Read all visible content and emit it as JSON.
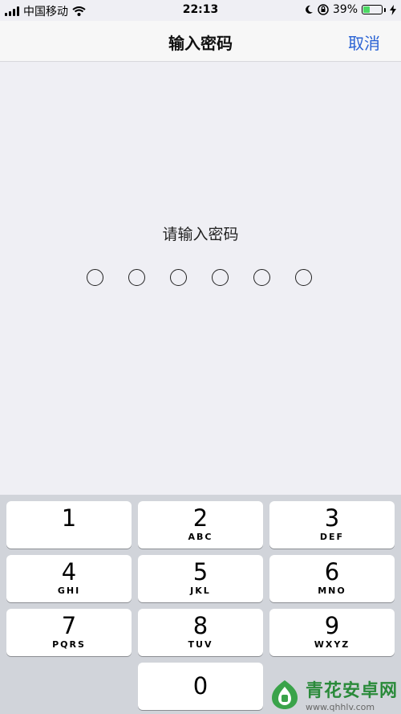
{
  "status_bar": {
    "carrier": "中国移动",
    "time": "22:13",
    "battery_percent": "39%",
    "battery_level": 0.39,
    "icons": [
      "signal-icon",
      "wifi-icon",
      "moon-icon",
      "orientation-lock-icon",
      "battery-icon",
      "charging-icon"
    ]
  },
  "nav": {
    "title": "输入密码",
    "cancel_label": "取消"
  },
  "passcode": {
    "prompt": "请输入密码",
    "digits_total": 6,
    "digits_entered": 0
  },
  "keypad": {
    "keys": [
      {
        "digit": "1",
        "letters": ""
      },
      {
        "digit": "2",
        "letters": "ABC"
      },
      {
        "digit": "3",
        "letters": "DEF"
      },
      {
        "digit": "4",
        "letters": "GHI"
      },
      {
        "digit": "5",
        "letters": "JKL"
      },
      {
        "digit": "6",
        "letters": "MNO"
      },
      {
        "digit": "7",
        "letters": "PQRS"
      },
      {
        "digit": "8",
        "letters": "TUV"
      },
      {
        "digit": "9",
        "letters": "WXYZ"
      },
      {
        "digit": "0",
        "letters": ""
      }
    ]
  },
  "watermark": {
    "name": "青花安卓网",
    "url": "www.qhhlv.com"
  },
  "colors": {
    "accent": "#2a63d4",
    "battery_fill": "#4cd964",
    "keypad_bg": "#d1d4da",
    "page_bg": "#efeff4"
  }
}
